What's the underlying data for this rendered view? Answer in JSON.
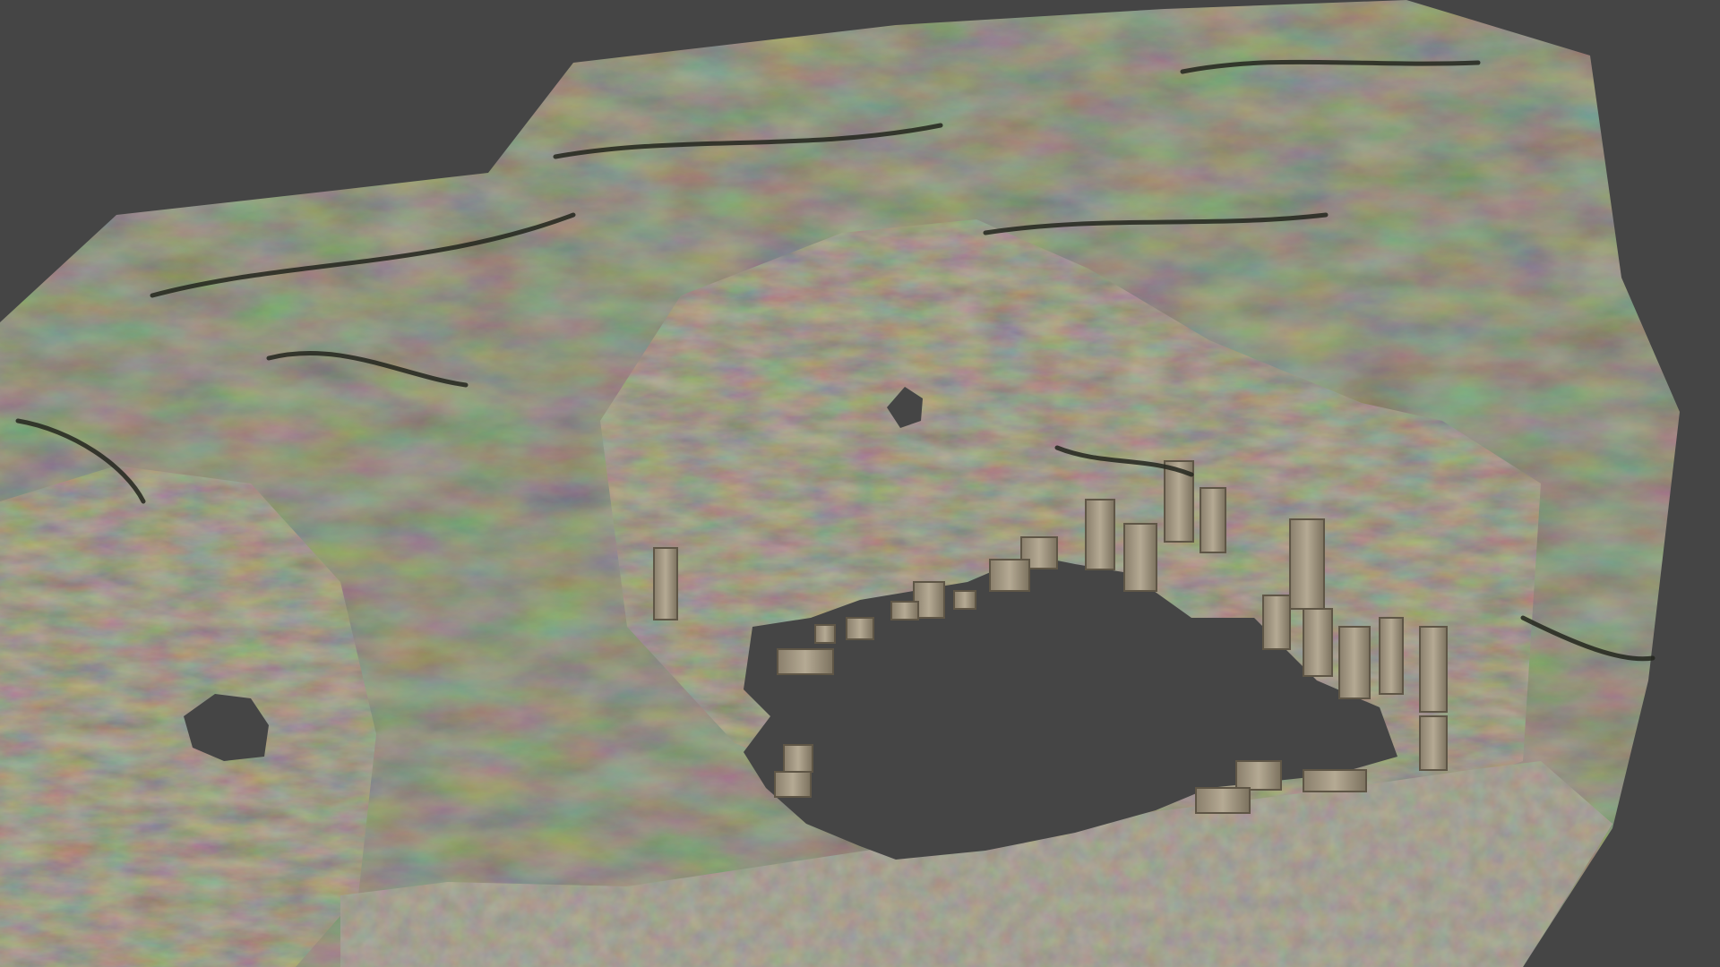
{
  "viewport": {
    "background_color": "#454545",
    "rock_base_color": "#4a4c3c",
    "rock_dark_color": "#2a2d22",
    "rock_light_color": "#7a7560",
    "floor_color": "#5c5647",
    "pillar_color": "#a99d88",
    "pillar_shadow_color": "#6d6454"
  },
  "scene": {
    "model_name_visible": "",
    "object_kind": "cave-rock-shell-3d-model"
  }
}
